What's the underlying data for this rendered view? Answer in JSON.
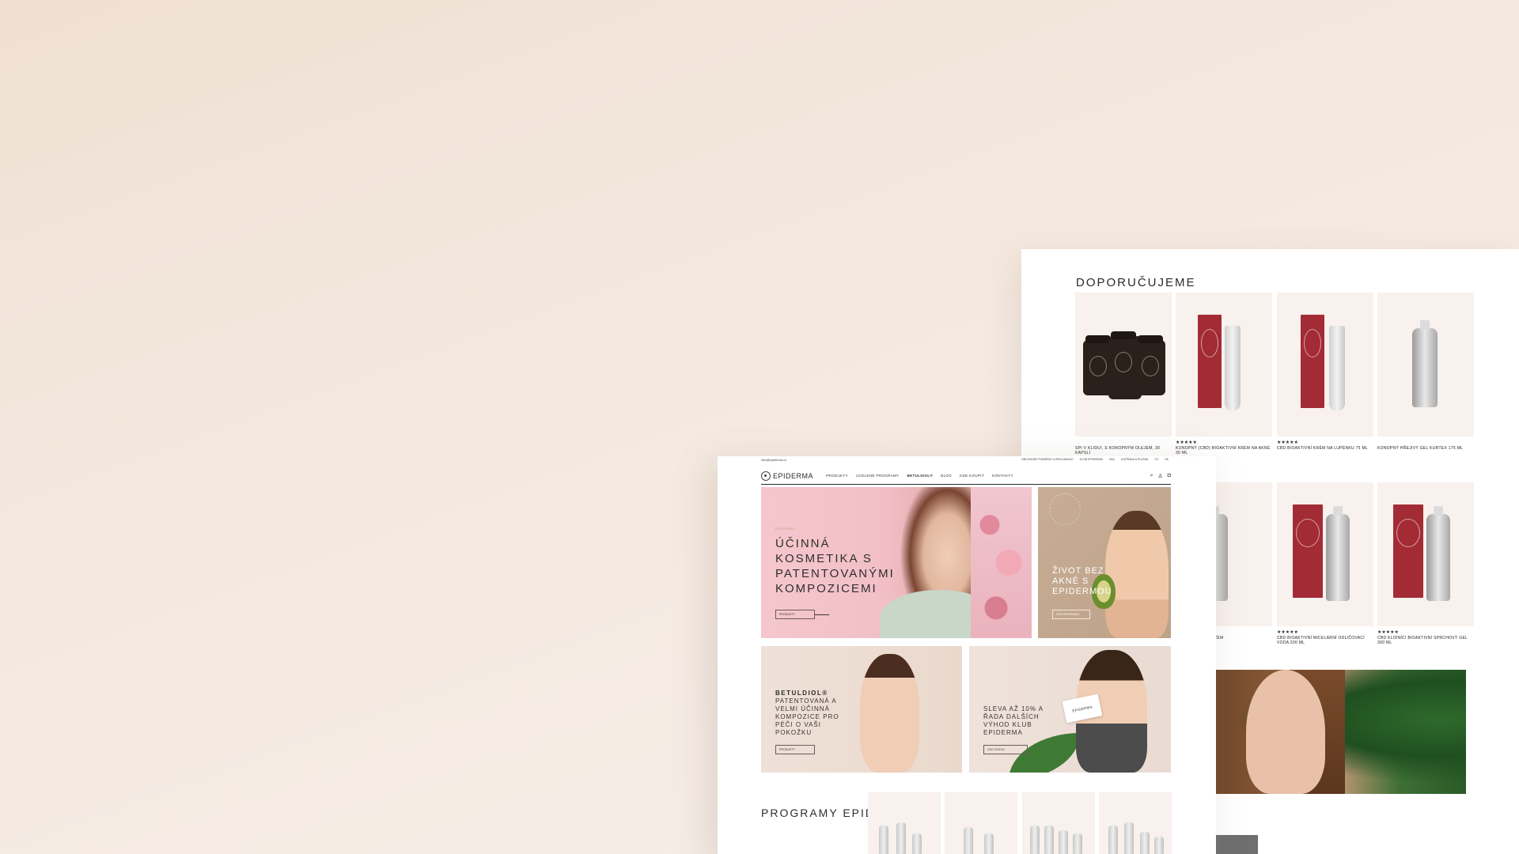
{
  "recommended": {
    "title": "DOPORUČUJEME",
    "products": [
      {
        "name": "SPI V KLIDU!, S KONOPNÝM OLEJEM, 30 KAPSLÍ",
        "stars": "",
        "price": ""
      },
      {
        "name": "KONOPNÝ (CBD) BIOAKTIVNÍ KRÉM NA AKNÉ 30 ML",
        "stars": "★★★★★",
        "price": ""
      },
      {
        "name": "CBD BIOAKTIVNÍ KRÉM NA LUPÉNKU 75 ML",
        "stars": "★★★★★",
        "price": ""
      },
      {
        "name": "KONOPNÝ HŘEJIVÝ GEL KURTEX 175 ML",
        "stars": "",
        "price": ""
      },
      {
        "name": "NÝ BALZÁM NA EKZÉM",
        "stars": "",
        "price": ""
      },
      {
        "name": "CBD BIOAKTIVNÍ MICELÁRNÍ ODLIČOVACÍ VODA 200 ML",
        "stars": "★★★★★",
        "price": ""
      },
      {
        "name": "CBD KLIDNÍCÍ BIOAKTIVNÍ SPRCHOVÝ GEL 300 ML",
        "stars": "★★★★★",
        "price": ""
      }
    ]
  },
  "site": {
    "brand": "EPIDERMA",
    "email": "info@epiderma.cz",
    "top_links": [
      "OBCHODNÍ PODMÍNKY A REKLAMACE",
      "KLUB EPIDERMA",
      "FAQ",
      "DOPRAVA A PLATBA",
      "CZ",
      "SK"
    ],
    "menu": [
      "PRODUKTY",
      "UCELENÉ PROGRAMY",
      "BETULDIOL®",
      "BLOG",
      "KDE KOUPIT",
      "KONTAKTY"
    ],
    "active_menu": "BETULDIOL®",
    "icons": [
      "search-icon",
      "user-icon",
      "cart-icon"
    ]
  },
  "hero_main": {
    "eyebrow": "EPIDERMA",
    "heading": "ÚČINNÁ KOSMETIKA S PATENTOVANÝMI KOMPOZICEMI",
    "button": "PRODUKTY"
  },
  "hero_side": {
    "heading": "ŽIVOT BEZ AKNÉ S EPIDERMOU",
    "button": "VÍCE INFORMACÍ"
  },
  "promo_betuldiol": {
    "title": "BETULDIOL®",
    "text": "PATENTOVANÁ A VELMI ÚČINNÁ KOMPOZICE PRO PÉČI O VAŠI POKOŽKU",
    "button": "PRODUKTY"
  },
  "promo_club": {
    "text": "SLEVA AŽ 10% A ŘADA DALŠÍCH VÝHOD KLUB EPIDERMA",
    "button": "CHCI SLEVU",
    "card_label": "EPIDERMA"
  },
  "programs": {
    "title": "PROGRAMY EPIDERMA"
  },
  "colors": {
    "page_background": "#f2e4da",
    "hero_pink": "#f5c7cd",
    "product_tile": "#f8f1ed",
    "accent_red_box": "#a32b35",
    "text_dark": "#2a2a2a"
  }
}
